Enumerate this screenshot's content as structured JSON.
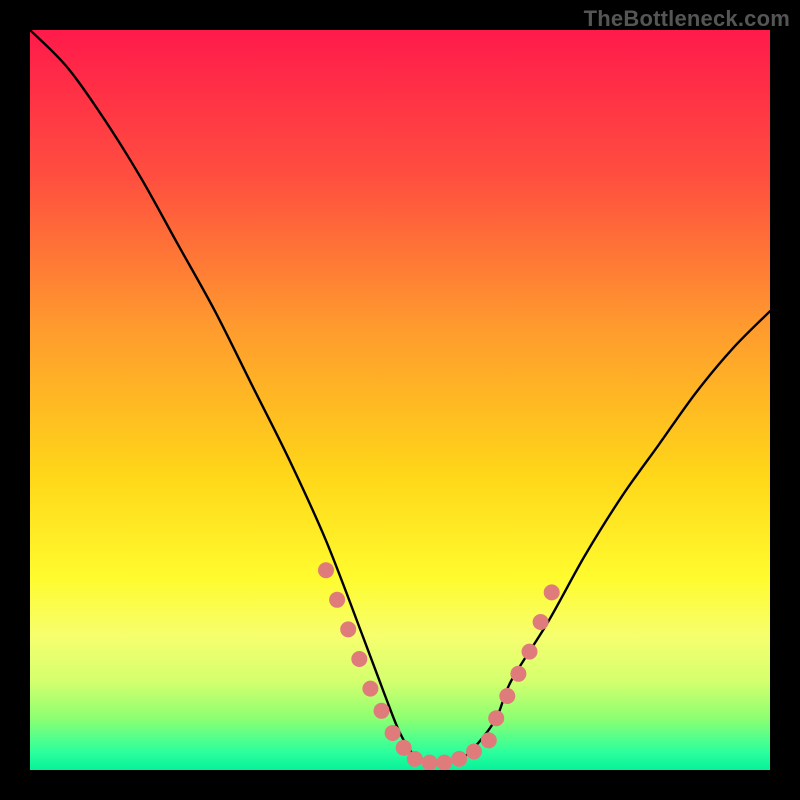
{
  "attribution": "TheBottleneck.com",
  "chart_data": {
    "type": "line",
    "title": "",
    "xlabel": "",
    "ylabel": "",
    "xlim": [
      0,
      100
    ],
    "ylim": [
      0,
      100
    ],
    "grid": false,
    "legend": false,
    "background_gradient_stops": [
      {
        "offset": 0.0,
        "color": "#ff1a4b"
      },
      {
        "offset": 0.2,
        "color": "#ff4f3f"
      },
      {
        "offset": 0.4,
        "color": "#ff9a2e"
      },
      {
        "offset": 0.6,
        "color": "#ffd619"
      },
      {
        "offset": 0.74,
        "color": "#fffb2e"
      },
      {
        "offset": 0.82,
        "color": "#f6ff6e"
      },
      {
        "offset": 0.88,
        "color": "#d4ff6e"
      },
      {
        "offset": 0.93,
        "color": "#8dff71"
      },
      {
        "offset": 0.975,
        "color": "#2dff9c"
      },
      {
        "offset": 1.0,
        "color": "#07f29a"
      }
    ],
    "curve": {
      "x": [
        0,
        5,
        10,
        15,
        20,
        25,
        30,
        35,
        40,
        45,
        48,
        50,
        52,
        55,
        58,
        60,
        63,
        65,
        70,
        75,
        80,
        85,
        90,
        95,
        100
      ],
      "y": [
        100,
        95,
        88,
        80,
        71,
        62,
        52,
        42,
        31,
        18,
        10,
        5,
        2,
        1,
        1.5,
        3,
        7,
        12,
        20,
        29,
        37,
        44,
        51,
        57,
        62
      ]
    },
    "markers": {
      "left_cluster": {
        "x": [
          40,
          41.5,
          43,
          44.5,
          46,
          47.5,
          49,
          50.5
        ],
        "y": [
          27,
          23,
          19,
          15,
          11,
          8,
          5,
          3
        ]
      },
      "bottom_cluster": {
        "x": [
          52,
          54,
          56,
          58,
          60,
          62
        ],
        "y": [
          1.5,
          1,
          1,
          1.5,
          2.5,
          4
        ]
      },
      "right_cluster": {
        "x": [
          63,
          64.5,
          66,
          67.5,
          69,
          70.5
        ],
        "y": [
          7,
          10,
          13,
          16,
          20,
          24
        ]
      },
      "color": "#e07b7b",
      "radius_px": 8
    }
  }
}
